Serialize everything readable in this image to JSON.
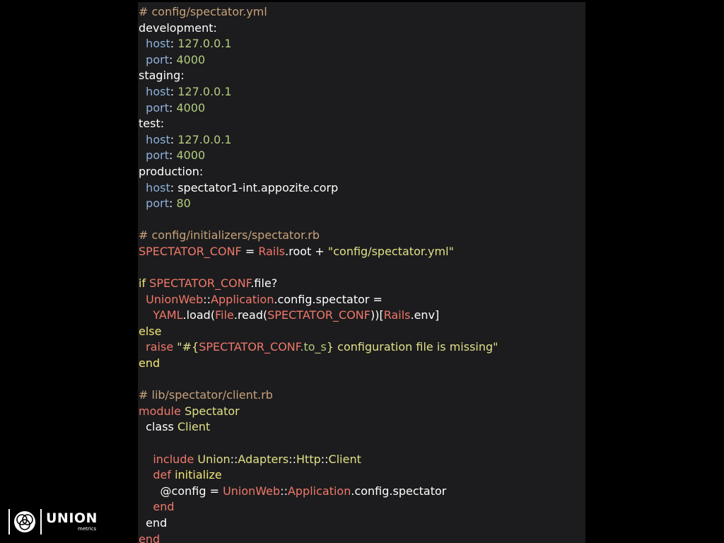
{
  "code_lines": [
    [
      {
        "t": "# config/spectator.yml",
        "c": "comment"
      }
    ],
    [
      {
        "t": "development:",
        "c": "plain"
      }
    ],
    [
      {
        "t": "  ",
        "c": "plain"
      },
      {
        "t": "host",
        "c": "key"
      },
      {
        "t": ": ",
        "c": "plain"
      },
      {
        "t": "127.0.0.1",
        "c": "val"
      }
    ],
    [
      {
        "t": "  ",
        "c": "plain"
      },
      {
        "t": "port",
        "c": "key"
      },
      {
        "t": ": ",
        "c": "plain"
      },
      {
        "t": "4000",
        "c": "val"
      }
    ],
    [
      {
        "t": "staging:",
        "c": "plain"
      }
    ],
    [
      {
        "t": "  ",
        "c": "plain"
      },
      {
        "t": "host",
        "c": "key"
      },
      {
        "t": ": ",
        "c": "plain"
      },
      {
        "t": "127.0.0.1",
        "c": "val"
      }
    ],
    [
      {
        "t": "  ",
        "c": "plain"
      },
      {
        "t": "port",
        "c": "key"
      },
      {
        "t": ": ",
        "c": "plain"
      },
      {
        "t": "4000",
        "c": "val"
      }
    ],
    [
      {
        "t": "test:",
        "c": "plain"
      }
    ],
    [
      {
        "t": "  ",
        "c": "plain"
      },
      {
        "t": "host",
        "c": "key"
      },
      {
        "t": ": ",
        "c": "plain"
      },
      {
        "t": "127.0.0.1",
        "c": "val"
      }
    ],
    [
      {
        "t": "  ",
        "c": "plain"
      },
      {
        "t": "port",
        "c": "key"
      },
      {
        "t": ": ",
        "c": "plain"
      },
      {
        "t": "4000",
        "c": "val"
      }
    ],
    [
      {
        "t": "production:",
        "c": "plain"
      }
    ],
    [
      {
        "t": "  ",
        "c": "plain"
      },
      {
        "t": "host",
        "c": "key"
      },
      {
        "t": ": spectator1-int.appozite.corp",
        "c": "plain"
      }
    ],
    [
      {
        "t": "  ",
        "c": "plain"
      },
      {
        "t": "port",
        "c": "key"
      },
      {
        "t": ": ",
        "c": "plain"
      },
      {
        "t": "80",
        "c": "val"
      }
    ],
    [],
    [
      {
        "t": "# config/initializers/spectator.rb",
        "c": "comment"
      }
    ],
    [
      {
        "t": "SPECTATOR_CONF",
        "c": "const"
      },
      {
        "t": " = ",
        "c": "plain"
      },
      {
        "t": "Rails",
        "c": "const"
      },
      {
        "t": ".root + ",
        "c": "plain"
      },
      {
        "t": "\"config/spectator.yml\"",
        "c": "str"
      }
    ],
    [],
    [
      {
        "t": "if",
        "c": "kw"
      },
      {
        "t": " ",
        "c": "plain"
      },
      {
        "t": "SPECTATOR_CONF",
        "c": "const"
      },
      {
        "t": ".file?",
        "c": "plain"
      }
    ],
    [
      {
        "t": "  ",
        "c": "plain"
      },
      {
        "t": "UnionWeb",
        "c": "const"
      },
      {
        "t": "::",
        "c": "plain"
      },
      {
        "t": "Application",
        "c": "const"
      },
      {
        "t": ".config.spectator =",
        "c": "plain"
      }
    ],
    [
      {
        "t": "    ",
        "c": "plain"
      },
      {
        "t": "YAML",
        "c": "const"
      },
      {
        "t": ".load(",
        "c": "plain"
      },
      {
        "t": "File",
        "c": "const"
      },
      {
        "t": ".read(",
        "c": "plain"
      },
      {
        "t": "SPECTATOR_CONF",
        "c": "const"
      },
      {
        "t": "))[",
        "c": "plain"
      },
      {
        "t": "Rails",
        "c": "const"
      },
      {
        "t": ".env]",
        "c": "plain"
      }
    ],
    [
      {
        "t": "else",
        "c": "kw"
      }
    ],
    [
      {
        "t": "  ",
        "c": "plain"
      },
      {
        "t": "raise",
        "c": "kwred"
      },
      {
        "t": " ",
        "c": "plain"
      },
      {
        "t": "\"#{",
        "c": "str"
      },
      {
        "t": "SPECTATOR_CONF",
        "c": "const"
      },
      {
        "t": ".to_s",
        "c": "val"
      },
      {
        "t": "} configuration file is missing\"",
        "c": "str"
      }
    ],
    [
      {
        "t": "end",
        "c": "kw"
      }
    ],
    [],
    [
      {
        "t": "# lib/spectator/client.rb",
        "c": "comment"
      }
    ],
    [
      {
        "t": "module",
        "c": "kwred"
      },
      {
        "t": " ",
        "c": "plain"
      },
      {
        "t": "Spectator",
        "c": "str"
      }
    ],
    [
      {
        "t": "  class ",
        "c": "plain"
      },
      {
        "t": "Client",
        "c": "str"
      }
    ],
    [],
    [
      {
        "t": "    ",
        "c": "plain"
      },
      {
        "t": "include",
        "c": "kwred"
      },
      {
        "t": " ",
        "c": "plain"
      },
      {
        "t": "Union",
        "c": "str"
      },
      {
        "t": "::",
        "c": "plain"
      },
      {
        "t": "Adapters",
        "c": "str"
      },
      {
        "t": "::",
        "c": "plain"
      },
      {
        "t": "Http",
        "c": "str"
      },
      {
        "t": "::",
        "c": "plain"
      },
      {
        "t": "Client",
        "c": "str"
      }
    ],
    [
      {
        "t": "    ",
        "c": "plain"
      },
      {
        "t": "def",
        "c": "kwred"
      },
      {
        "t": " ",
        "c": "plain"
      },
      {
        "t": "initialize",
        "c": "kw"
      }
    ],
    [
      {
        "t": "      @config = ",
        "c": "plain"
      },
      {
        "t": "UnionWeb",
        "c": "const"
      },
      {
        "t": "::",
        "c": "plain"
      },
      {
        "t": "Application",
        "c": "const"
      },
      {
        "t": ".config.spectator",
        "c": "plain"
      }
    ],
    [
      {
        "t": "    ",
        "c": "plain"
      },
      {
        "t": "end",
        "c": "kwred"
      }
    ],
    [
      {
        "t": "  end",
        "c": "plain"
      }
    ],
    [
      {
        "t": "end",
        "c": "kwred"
      }
    ]
  ],
  "brand": {
    "name": "UNION",
    "tagline": "metrics",
    "logo_icon": "union-metrics-logo-icon"
  }
}
